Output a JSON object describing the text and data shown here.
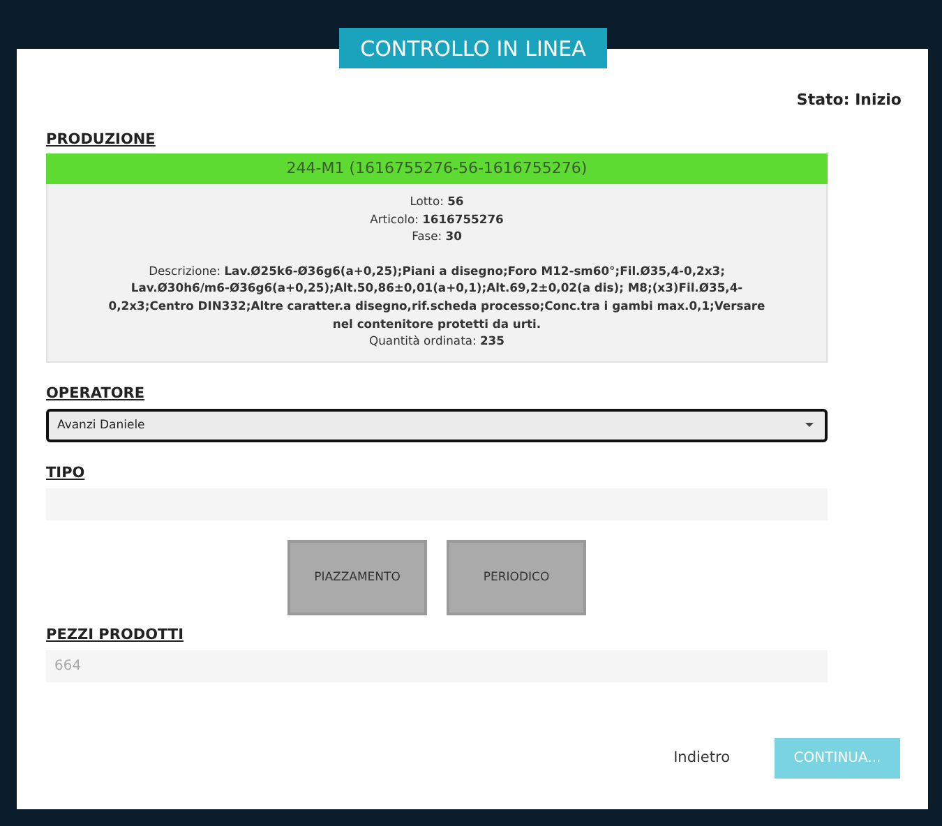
{
  "dialog": {
    "title": "CONTROLLO IN LINEA",
    "status": "Stato: Inizio"
  },
  "production": {
    "label": "PRODUZIONE",
    "header": "244-M1 (1616755276-56-1616755276)",
    "details": [
      "Lotto: **56**",
      "Articolo: **1616755276**",
      "Fase: **30**"
    ],
    "description": "Descrizione: **Lav.Ø25k6-Ø36g6(a+0,25);Piani a disegno;Foro M12-sm60°;Fil.Ø35,4-0,2x3; Lav.Ø30h6/m6-Ø36g6(a+0,25);Alt.50,86±0,01(a+0,1);Alt.69,2±0,02(a dis); M8;(x3)Fil.Ø35,4-0,2x3;Centro DIN332;Altre caratter.a disegno,rif.scheda processo;Conc.tra i gambi max.0,1;Versare nel contenitore protetti da urti.**",
    "quantity": "Quantità ordinata: **235**"
  },
  "operator": {
    "label": "OPERATORE",
    "value": "Avanzi Daniele"
  },
  "type": {
    "label": "TIPO",
    "options": [
      {
        "label": "PIAZZAMENTO",
        "selected": false
      },
      {
        "label": "PERIODICO",
        "selected": false
      }
    ]
  },
  "pieces": {
    "label": "PEZZI PRODOTTI",
    "placeholder": "664"
  },
  "footer": {
    "back": "Indietro",
    "continue": {
      "label": "CONTINUA...",
      "disabled": true
    }
  }
}
